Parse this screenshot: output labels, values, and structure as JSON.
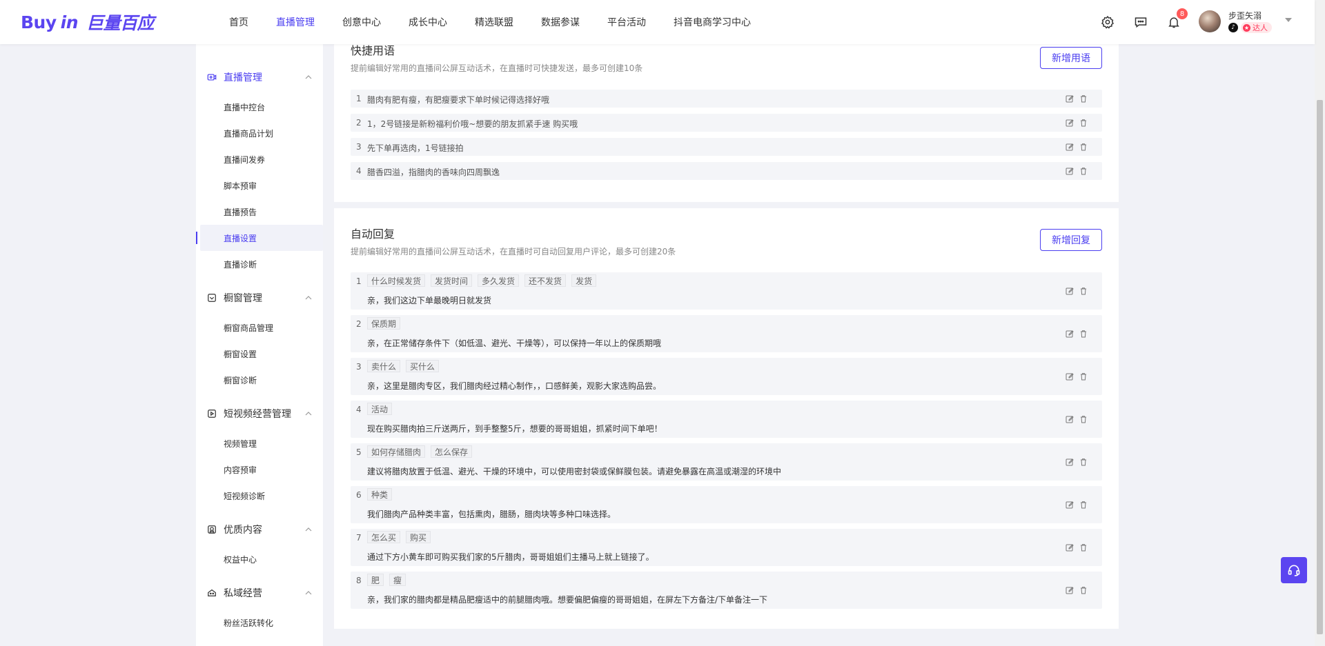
{
  "brand": {
    "logo_buy": "Buy",
    "logo_in": "in",
    "logo_cn": "巨量百应"
  },
  "nav": [
    "首页",
    "直播管理",
    "创意中心",
    "成长中心",
    "精选联盟",
    "数据参谋",
    "平台活动",
    "抖音电商学习中心"
  ],
  "header": {
    "badge_count": "8",
    "user_name": "步歪矢溺",
    "user_tag": "达人"
  },
  "sidebar": {
    "groups": [
      {
        "title": "直播管理",
        "icon": "live-icon",
        "items": [
          "直播中控台",
          "直播商品计划",
          "直播间发券",
          "脚本预审",
          "直播预告",
          "直播设置",
          "直播诊断"
        ]
      },
      {
        "title": "橱窗管理",
        "icon": "showcase-icon",
        "items": [
          "橱窗商品管理",
          "橱窗设置",
          "橱窗诊断"
        ]
      },
      {
        "title": "短视频经营管理",
        "icon": "video-icon",
        "items": [
          "视频管理",
          "内容预审",
          "短视频诊断"
        ]
      },
      {
        "title": "优质内容",
        "icon": "quality-icon",
        "items": [
          "权益中心"
        ]
      },
      {
        "title": "私域经营",
        "icon": "private-icon",
        "items": [
          "粉丝活跃转化"
        ]
      }
    ],
    "active_item": "直播设置"
  },
  "quick_phrases": {
    "title": "快捷用语",
    "desc": "提前编辑好常用的直播间公屏互动话术，在直播时可快捷发送，最多可创建10条",
    "add_label": "新增用语",
    "items": [
      {
        "num": "1",
        "text": "腊肉有肥有瘦，有肥瘦要求下单时候记得选择好哦"
      },
      {
        "num": "2",
        "text": "1，2号链接是新粉福利价哦~想要的朋友抓紧手速 购买哦"
      },
      {
        "num": "3",
        "text": "先下单再选肉，1号链接拍"
      },
      {
        "num": "4",
        "text": "腊香四溢，指腊肉的香味向四周飘逸"
      }
    ]
  },
  "auto_reply": {
    "title": "自动回复",
    "desc": "提前编辑好常用的直播间公屏互动话术，在直播时可自动回复用户评论，最多可创建20条",
    "add_label": "新增回复",
    "items": [
      {
        "num": "1",
        "keywords": [
          "什么时候发货",
          "发货时间",
          "多久发货",
          "还不发货",
          "发货"
        ],
        "reply": "亲，我们这边下单最晚明日就发货"
      },
      {
        "num": "2",
        "keywords": [
          "保质期"
        ],
        "reply": "亲，在正常储存条件下（如低温、避光、干燥等），可以保持一年以上的保质期哦"
      },
      {
        "num": "3",
        "keywords": [
          "卖什么",
          "买什么"
        ],
        "reply": "亲，这里是腊肉专区，我们腊肉经过精心制作，，口感鲜美，观影大家选购品尝。"
      },
      {
        "num": "4",
        "keywords": [
          "活动"
        ],
        "reply": "现在购买腊肉拍三斤送两斤，到手整整5斤，想要的哥哥姐姐，抓紧时间下单吧！"
      },
      {
        "num": "5",
        "keywords": [
          "如何存储腊肉",
          "怎么保存"
        ],
        "reply": "建议将腊肉放置于低温、避光、干燥的环境中，可以使用密封袋或保鲜膜包装。请避免暴露在高温或潮湿的环境中"
      },
      {
        "num": "6",
        "keywords": [
          "种类"
        ],
        "reply": "我们腊肉产品种类丰富，包括熏肉，腊肠，腊肉块等多种口味选择。"
      },
      {
        "num": "7",
        "keywords": [
          "怎么买",
          "购买"
        ],
        "reply": "通过下方小黄车即可购买我们家的5斤腊肉，哥哥姐姐们主播马上就上链接了。"
      },
      {
        "num": "8",
        "keywords": [
          "肥",
          "瘦"
        ],
        "reply": "亲，我们家的腊肉都是精品肥瘦适中的前腿腊肉哦。想要偏肥偏瘦的哥哥姐姐，在屏左下方备注/下单备注一下"
      }
    ]
  },
  "colors": {
    "accent": "#4a3df0",
    "badge": "#ff5a5a"
  }
}
